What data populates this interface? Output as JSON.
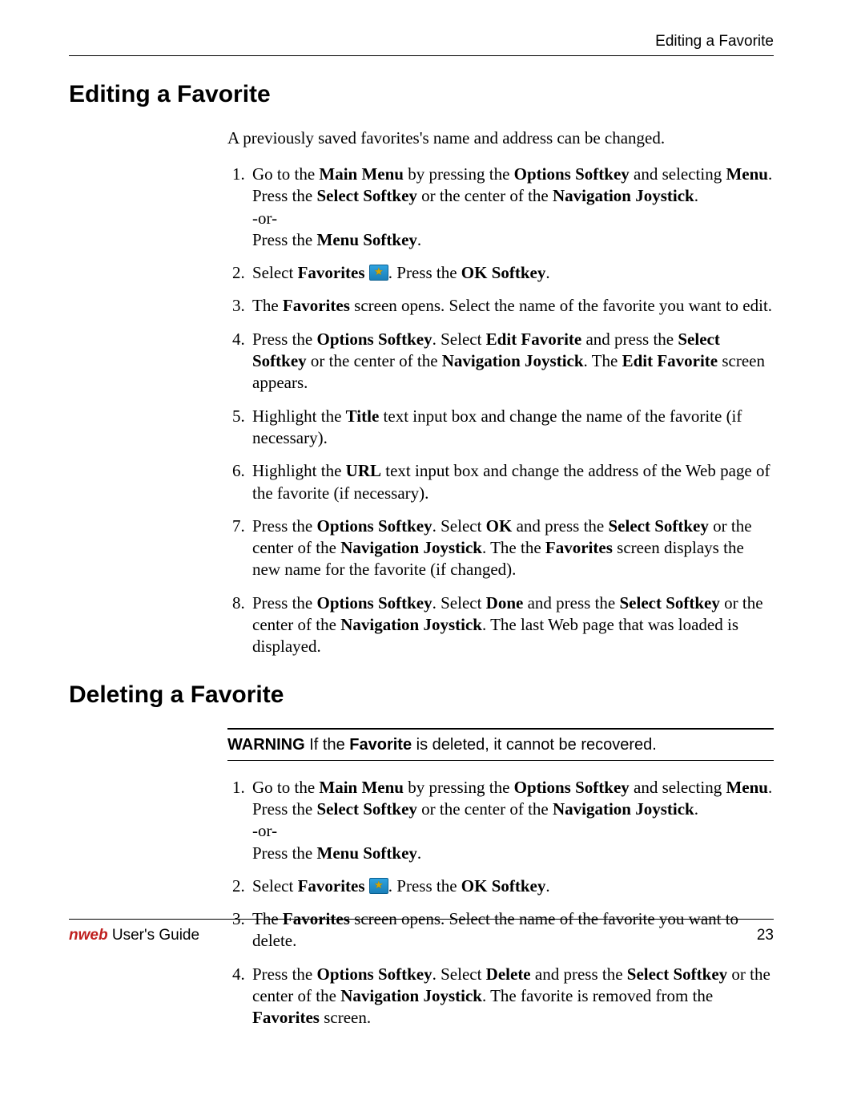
{
  "runningHead": "Editing a Favorite",
  "section1": {
    "title": "Editing a Favorite",
    "intro": "A previously saved favorites's name and address can be changed."
  },
  "s1steps": {
    "i1": {
      "a": "Go to the ",
      "b": "Main Menu",
      "c": " by pressing the ",
      "d": "Options Softkey",
      "e": " and selecting ",
      "f": "Menu",
      "g": ". Press the ",
      "h": "Select Softkey",
      "i": " or the center of the ",
      "j": "Navigation Joystick",
      "k": ".",
      "or": "-or-",
      "l": "Press the ",
      "m": "Menu Softkey",
      "n": "."
    },
    "i2": {
      "a": "Select ",
      "b": "Favorites",
      "c": ". Press the ",
      "d": "OK Softkey",
      "e": "."
    },
    "i3": {
      "a": "The ",
      "b": "Favorites",
      "c": " screen opens. Select the name of the favorite you want to edit."
    },
    "i4": {
      "a": "Press the ",
      "b": "Options Softkey",
      "c": ". Select ",
      "d": "Edit Favorite",
      "e": " and press the ",
      "f": "Select Softkey",
      "g": " or the center of the ",
      "h": "Navigation Joystick",
      "i": ". The ",
      "j": "Edit Favorite",
      "k": " screen appears."
    },
    "i5": {
      "a": "Highlight the ",
      "b": "Title",
      "c": " text input box and change the name of the favorite (if necessary)."
    },
    "i6": {
      "a": "Highlight the ",
      "b": "URL",
      "c": " text input box and change the address of the Web page of the favorite (if necessary)."
    },
    "i7": {
      "a": "Press the ",
      "b": "Options Softkey",
      "c": ". Select ",
      "d": "OK",
      "e": " and press the ",
      "f": "Select Softkey",
      "g": " or the center of the ",
      "h": "Navigation Joystick",
      "i": ". The the ",
      "j": "Favorites",
      "k": " screen displays the new name for the favorite (if changed)."
    },
    "i8": {
      "a": "Press the ",
      "b": "Options Softkey",
      "c": ". Select ",
      "d": "Done",
      "e": " and press the ",
      "f": "Select Softkey",
      "g": " or the center of the ",
      "h": "Navigation Joystick",
      "i": ". The last Web page that was loaded is displayed."
    }
  },
  "section2": {
    "title": "Deleting a Favorite"
  },
  "warning": {
    "label": "WARNING",
    "a": "  If the ",
    "b": "Favorite",
    "c": " is deleted, it cannot be recovered."
  },
  "s2steps": {
    "i1": {
      "a": "Go to the ",
      "b": "Main Menu",
      "c": " by pressing the ",
      "d": "Options Softkey",
      "e": " and selecting ",
      "f": "Menu",
      "g": ". Press the ",
      "h": "Select Softkey",
      "i": " or the center of the ",
      "j": "Navigation Joystick",
      "k": ".",
      "or": "-or-",
      "l": "Press the ",
      "m": "Menu Softkey",
      "n": "."
    },
    "i2": {
      "a": "Select ",
      "b": "Favorites",
      "c": ". Press the ",
      "d": "OK Softkey",
      "e": "."
    },
    "i3": {
      "a": "The ",
      "b": "Favorites",
      "c": " screen opens. Select the name of the favorite you want to delete."
    },
    "i4": {
      "a": "Press the ",
      "b": "Options Softkey",
      "c": ". Select ",
      "d": "Delete",
      "e": " and press the ",
      "f": "Select Softkey",
      "g": " or the center of the ",
      "h": "Navigation Joystick",
      "i": ". The favorite is removed from the ",
      "j": "Favorites",
      "k": " screen."
    }
  },
  "footer": {
    "brand": "nweb",
    "title": " User's Guide",
    "page": "23"
  }
}
